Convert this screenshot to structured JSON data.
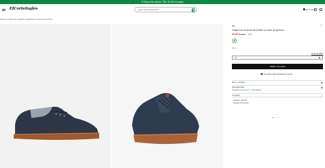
{
  "topbar": {
    "text": "9 Plazos Sin Interés. TAE: 0% Sin 3 cuotas"
  },
  "header": {
    "logo": "ElCorteInglés",
    "search_placeholder": "¿Qué estás buscando?",
    "user_label": "Mi Cuenta"
  },
  "breadcrumb": "Zapatos Hombre Xti / Zapatos / Zapatos de cordones de hombre",
  "product": {
    "brand": "Xti",
    "title": "Zapatos de cordones de hombre y mucho de gamuza",
    "price": "39,90 €",
    "old_price": "49,95 €",
    "discount": "-20%",
    "color_label": "Azul",
    "size_guide": "Guía de tallas",
    "size_select": "44",
    "add_button": "Añadir a la cesta",
    "availability": "Consultar disponibilidad en tienda"
  },
  "accordion": [
    {
      "label": "Envío y cambios",
      "sub": ""
    },
    {
      "label": "Recogida gratis",
      "sub": "Recogida en tienda en 2 - 3 días hábiles"
    },
    {
      "label": "Compartir",
      "sub": ""
    }
  ],
  "delivery": [
    "Entrega a domicilio",
    "Llegará el 18 de abril"
  ],
  "colors": {
    "accent": "#0a8a44",
    "price": "#d0342c",
    "button": "#111111"
  },
  "icons": [
    "menu-icon",
    "search-icon",
    "user-icon",
    "heart-icon",
    "eco-icon",
    "share-icon",
    "chevron-down-icon",
    "store-icon"
  ]
}
